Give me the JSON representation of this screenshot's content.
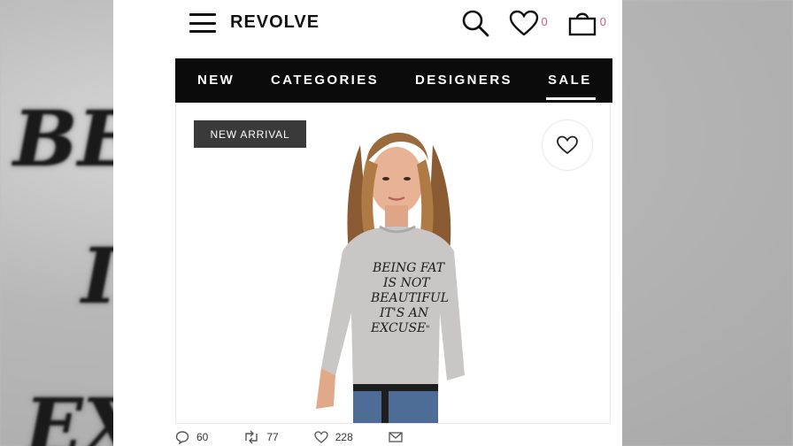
{
  "background": {
    "text_top": "BE",
    "text_mid": "I",
    "text_bottom": "EX"
  },
  "header": {
    "logo": "REVOLVE",
    "wishlist_count": "0",
    "bag_count": "0",
    "icons": [
      "menu-icon",
      "search-icon",
      "heart-icon",
      "shopping-bag-icon"
    ]
  },
  "nav": {
    "items": [
      "NEW",
      "CATEGORIES",
      "DESIGNERS",
      "SALE"
    ],
    "active": "SALE"
  },
  "product": {
    "badge": "NEW ARRIVAL",
    "shirt_text": [
      "BEING FAT",
      "IS NOT",
      "BEAUTIFUL",
      "IT'S AN",
      "EXCUSE",
      "\""
    ]
  },
  "social": {
    "comments": "60",
    "retweets": "77",
    "likes": "228"
  },
  "colors": {
    "accent": "#c75b8a",
    "nav_bg": "#0b0b0b",
    "badge_bg": "#3a3a3a"
  }
}
